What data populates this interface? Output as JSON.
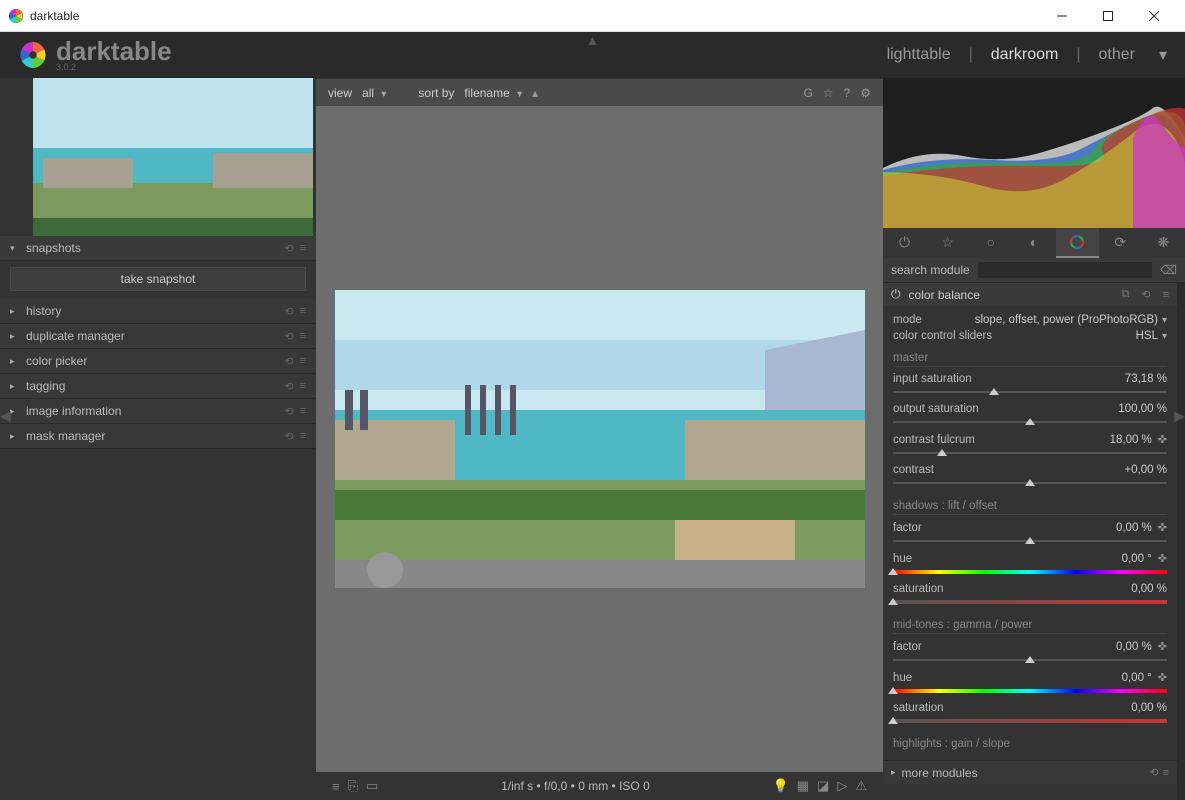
{
  "window": {
    "title": "darktable"
  },
  "brand": {
    "name": "darktable",
    "version": "3.0.2"
  },
  "topnav": {
    "lighttable": "lighttable",
    "darkroom": "darkroom",
    "other": "other",
    "sep": "|"
  },
  "left_panels": {
    "snapshots": "snapshots",
    "take_snapshot": "take snapshot",
    "history": "history",
    "duplicate_manager": "duplicate manager",
    "color_picker": "color picker",
    "tagging": "tagging",
    "image_information": "image information",
    "mask_manager": "mask manager"
  },
  "center_top": {
    "view_label": "view",
    "view_value": "all",
    "sort_label": "sort by",
    "sort_value": "filename",
    "g": "G"
  },
  "status_bar": "1/inf s • f/0,0 • 0 mm • ISO 0",
  "right": {
    "search_label": "search module",
    "module_title": "color balance",
    "mode_label": "mode",
    "mode_value": "slope, offset, power (ProPhotoRGB)",
    "sliders_label": "color control sliders",
    "sliders_value": "HSL",
    "sections": {
      "master": "master",
      "shadows": "shadows : lift / offset",
      "midtones": "mid-tones : gamma / power",
      "highlights": "highlights : gain / slope"
    },
    "master": {
      "input_sat_label": "input saturation",
      "input_sat_val": "73,18 %",
      "output_sat_label": "output saturation",
      "output_sat_val": "100,00 %",
      "fulcrum_label": "contrast fulcrum",
      "fulcrum_val": "18,00 %",
      "contrast_label": "contrast",
      "contrast_val": "+0,00 %"
    },
    "shadows": {
      "factor_label": "factor",
      "factor_val": "0,00 %",
      "hue_label": "hue",
      "hue_val": "0,00 °",
      "sat_label": "saturation",
      "sat_val": "0,00 %"
    },
    "midtones": {
      "factor_label": "factor",
      "factor_val": "0,00 %",
      "hue_label": "hue",
      "hue_val": "0,00 °",
      "sat_label": "saturation",
      "sat_val": "0,00 %"
    },
    "more_modules": "more modules"
  }
}
